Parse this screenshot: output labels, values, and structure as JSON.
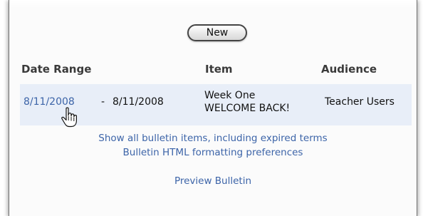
{
  "toolbar": {
    "new_label": "New"
  },
  "table": {
    "headers": {
      "date_range": "Date Range",
      "item": "Item",
      "audience": "Audience"
    },
    "rows": [
      {
        "start_date": "8/11/2008",
        "separator": "-",
        "end_date": "8/11/2008",
        "item_line1": "Week One",
        "item_line2": "WELCOME BACK!",
        "audience": "Teacher Users"
      }
    ]
  },
  "links": {
    "show_all": "Show all bulletin items, including expired terms",
    "formatting": "Bulletin HTML formatting preferences",
    "preview": "Preview Bulletin"
  },
  "icons": {
    "cursor": "hand-pointer-icon"
  },
  "colors": {
    "link": "#3c64a8",
    "row_highlight": "#e8eef8",
    "header_text": "#3a3a3a"
  }
}
